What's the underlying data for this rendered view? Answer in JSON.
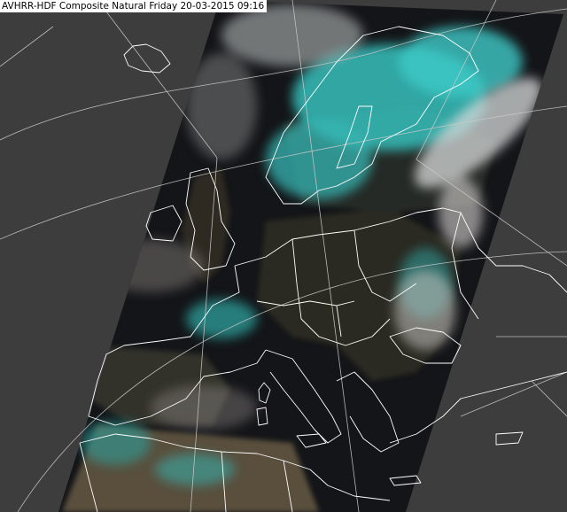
{
  "caption": {
    "text": "AVHRR-HDF Composite Natural Friday 20-03-2015 09:16"
  },
  "map": {
    "projection": "polar stereographic",
    "background_color": "#3d3d3d",
    "graticule_color": "#c9c9c9",
    "coastline_color": "#ffffff",
    "swath": {
      "sea_color": "#101114",
      "land_color": "#2b2820",
      "cloud_color": "#d8d4cf",
      "snow_ice_color": "#38c8c6"
    }
  }
}
